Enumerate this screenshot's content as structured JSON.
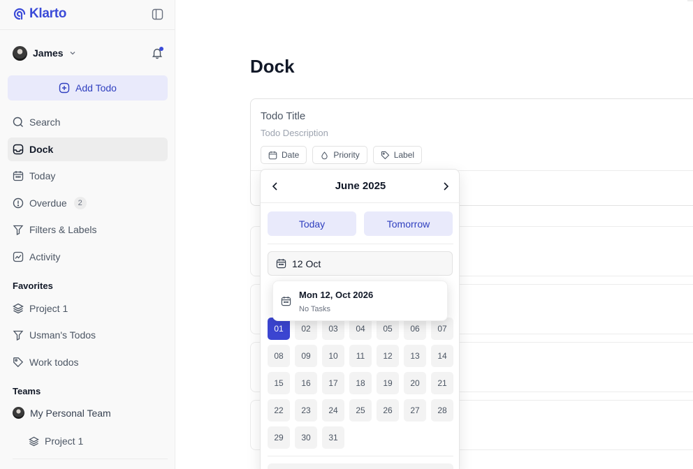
{
  "app": {
    "name": "Klarto",
    "brand_color": "#3b4bd8"
  },
  "sidebar": {
    "user": {
      "name": "James"
    },
    "add_todo": "Add Todo",
    "nav": [
      {
        "label": "Search",
        "icon": "search-icon"
      },
      {
        "label": "Dock",
        "icon": "inbox-icon",
        "active": true
      },
      {
        "label": "Today",
        "icon": "calendar-icon"
      },
      {
        "label": "Overdue",
        "icon": "alert-circle-icon",
        "badge": "2"
      },
      {
        "label": "Filters & Labels",
        "icon": "filter-icon"
      },
      {
        "label": "Activity",
        "icon": "activity-icon"
      }
    ],
    "favorites_title": "Favorites",
    "favorites": [
      {
        "label": "Project 1",
        "icon": "layers-icon"
      },
      {
        "label": "Usman's Todos",
        "icon": "filter-icon"
      },
      {
        "label": "Work todos",
        "icon": "tag-icon"
      }
    ],
    "teams_title": "Teams",
    "team": {
      "name": "My Personal Team",
      "project": "Project 1"
    }
  },
  "main": {
    "title": "Dock",
    "editor": {
      "title_placeholder": "Todo Title",
      "description_placeholder": "Todo Description",
      "chips": {
        "date": "Date",
        "priority": "Priority",
        "label": "Label"
      }
    }
  },
  "datepicker": {
    "month": "June 2025",
    "quick": {
      "today": "Today",
      "tomorrow": "Tomorrow"
    },
    "input_value": "12 Oct",
    "tooltip": {
      "title": "Mon 12, Oct 2026",
      "subtitle": "No Tasks"
    },
    "days": [
      "01",
      "02",
      "03",
      "04",
      "05",
      "06",
      "07",
      "08",
      "09",
      "10",
      "11",
      "12",
      "13",
      "14",
      "15",
      "16",
      "17",
      "18",
      "19",
      "20",
      "21",
      "22",
      "23",
      "24",
      "25",
      "26",
      "27",
      "28",
      "29",
      "30",
      "31"
    ],
    "selected_day": "01",
    "selected_color": "#3b45d1"
  }
}
